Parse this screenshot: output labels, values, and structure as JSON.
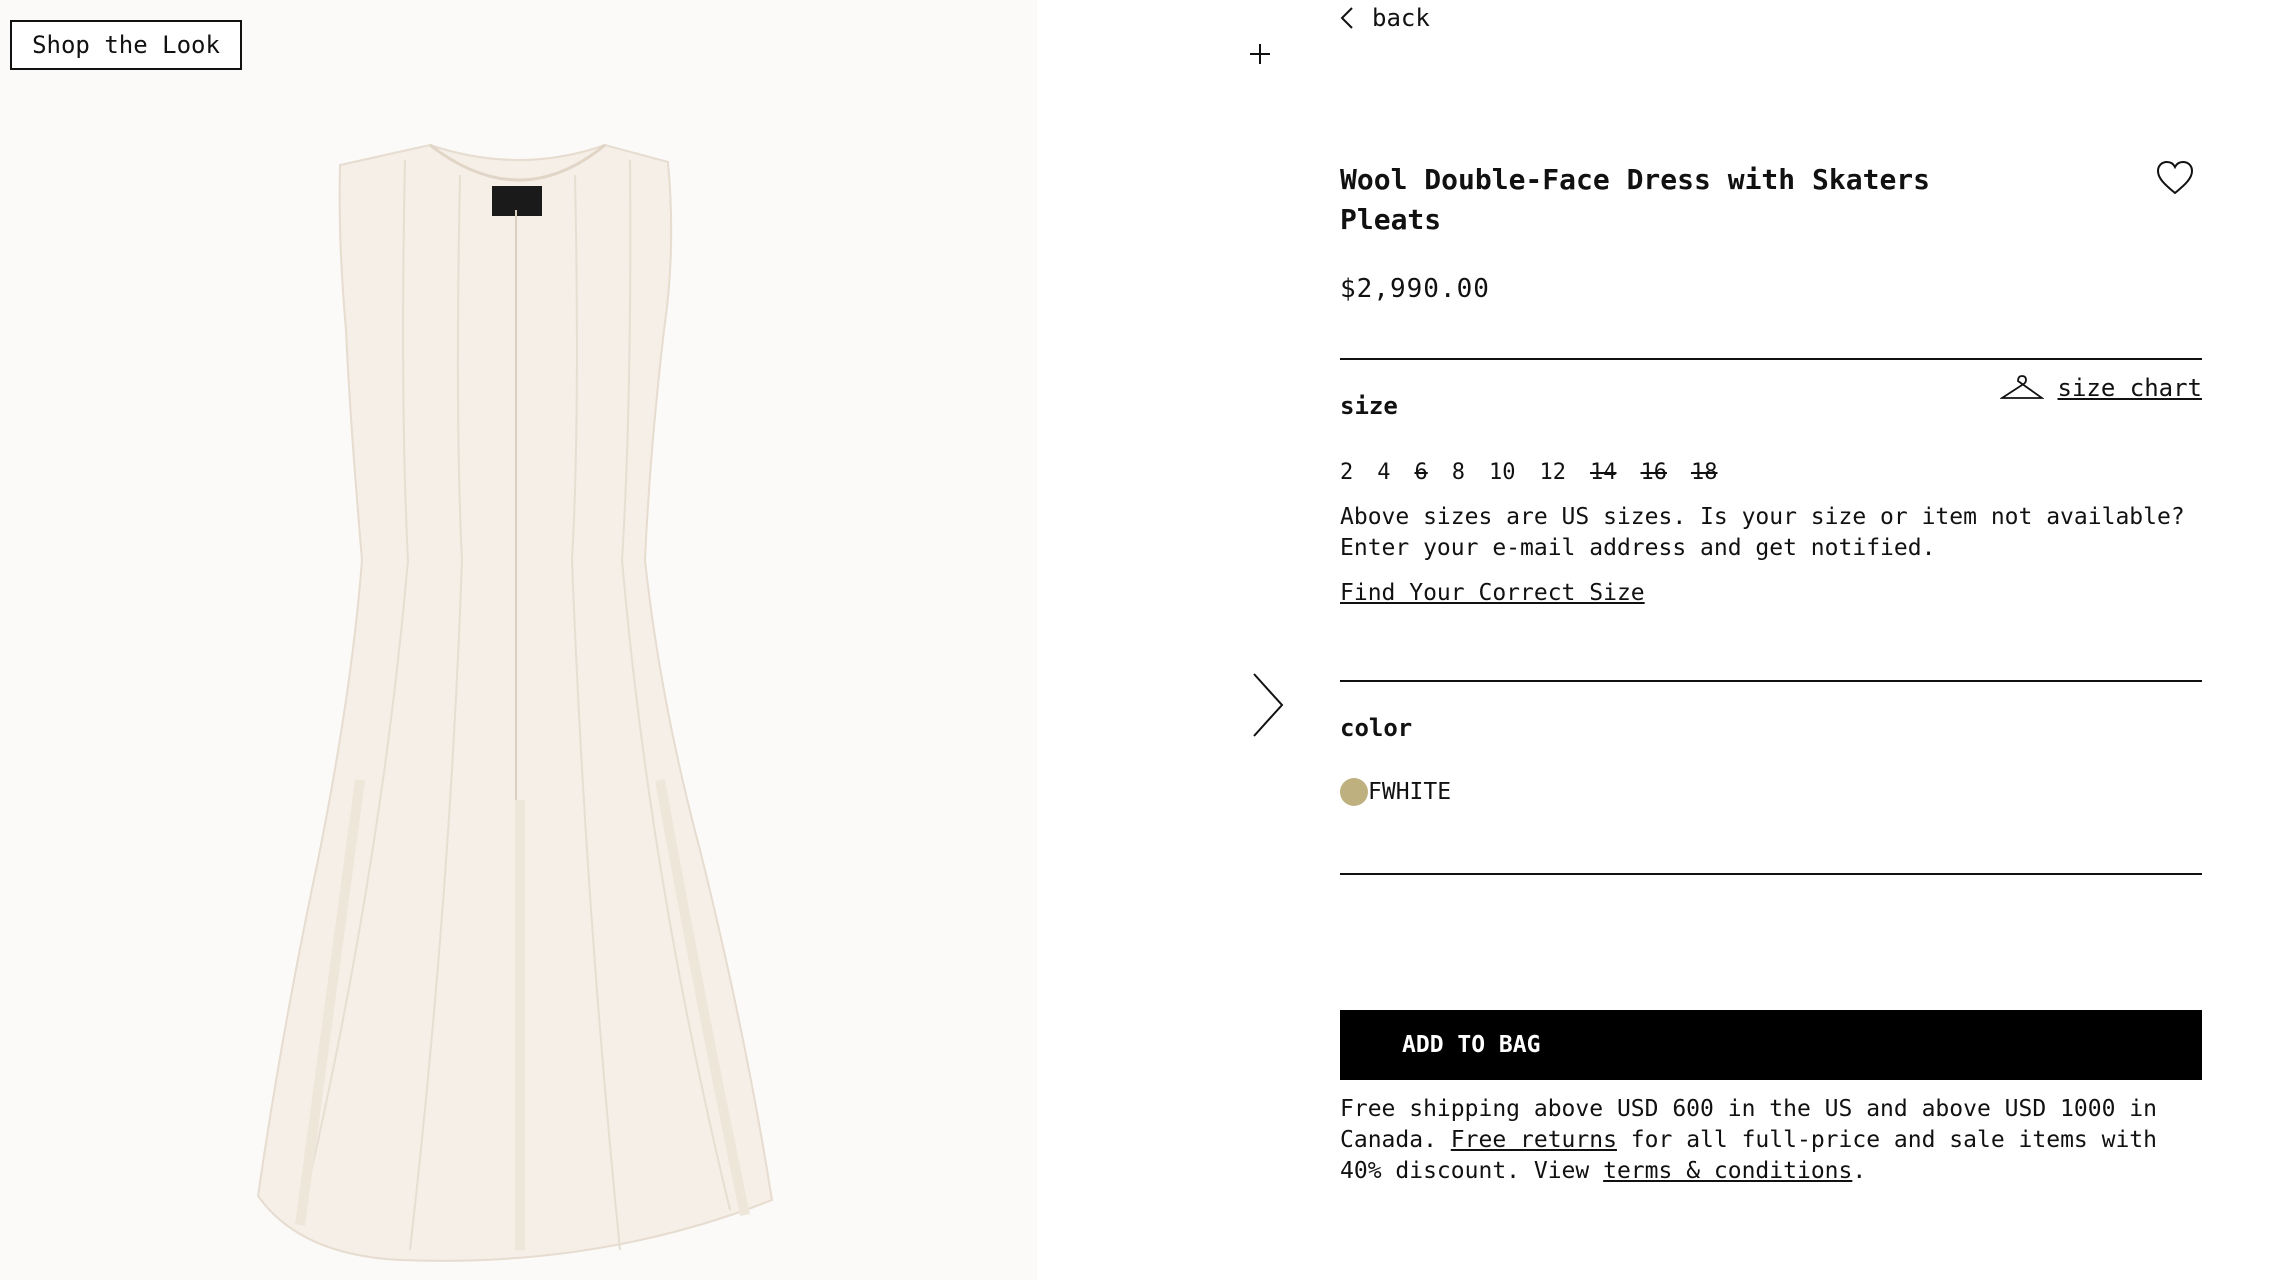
{
  "image_panel": {
    "shop_the_look_label": "Shop the Look",
    "image_alt": "Wool Double-Face Dress with Skaters Pleats"
  },
  "nav": {
    "back_label": "back",
    "plus_icon": "plus-icon",
    "next_icon": "chevron-right-icon"
  },
  "product": {
    "title": "Wool Double-Face Dress with Skaters Pleats",
    "price": "$2,990.00"
  },
  "size_section": {
    "label": "size",
    "size_chart_label": "size chart",
    "size_chart_icon": "hanger-icon",
    "options": [
      {
        "label": "2",
        "available": true
      },
      {
        "label": "4",
        "available": true
      },
      {
        "label": "6",
        "available": false
      },
      {
        "label": "8",
        "available": true
      },
      {
        "label": "10",
        "available": true
      },
      {
        "label": "12",
        "available": true
      },
      {
        "label": "14",
        "available": false
      },
      {
        "label": "16",
        "available": false
      },
      {
        "label": "18",
        "available": false
      }
    ],
    "note": "Above sizes are US sizes. Is your size or item not available? Enter your e-mail address and get notified.",
    "find_size_label": "Find Your Correct Size"
  },
  "color_section": {
    "label": "color",
    "selected_name": "FWHITE",
    "swatch_color": "#bfb07f"
  },
  "cart": {
    "add_to_bag_label": "ADD TO BAG"
  },
  "shipping": {
    "text_1": "Free shipping above USD 600 in the US and above USD 1000 in Canada. ",
    "returns_link": "Free returns",
    "text_2": " for all full-price and sale items with 40% discount. View ",
    "terms_link": "terms & conditions",
    "text_3": "."
  },
  "colors": {
    "dress": "#f7f1ea",
    "dress_shadow": "#ece3d8",
    "background": "#fbfaf8",
    "button": "#000000"
  }
}
